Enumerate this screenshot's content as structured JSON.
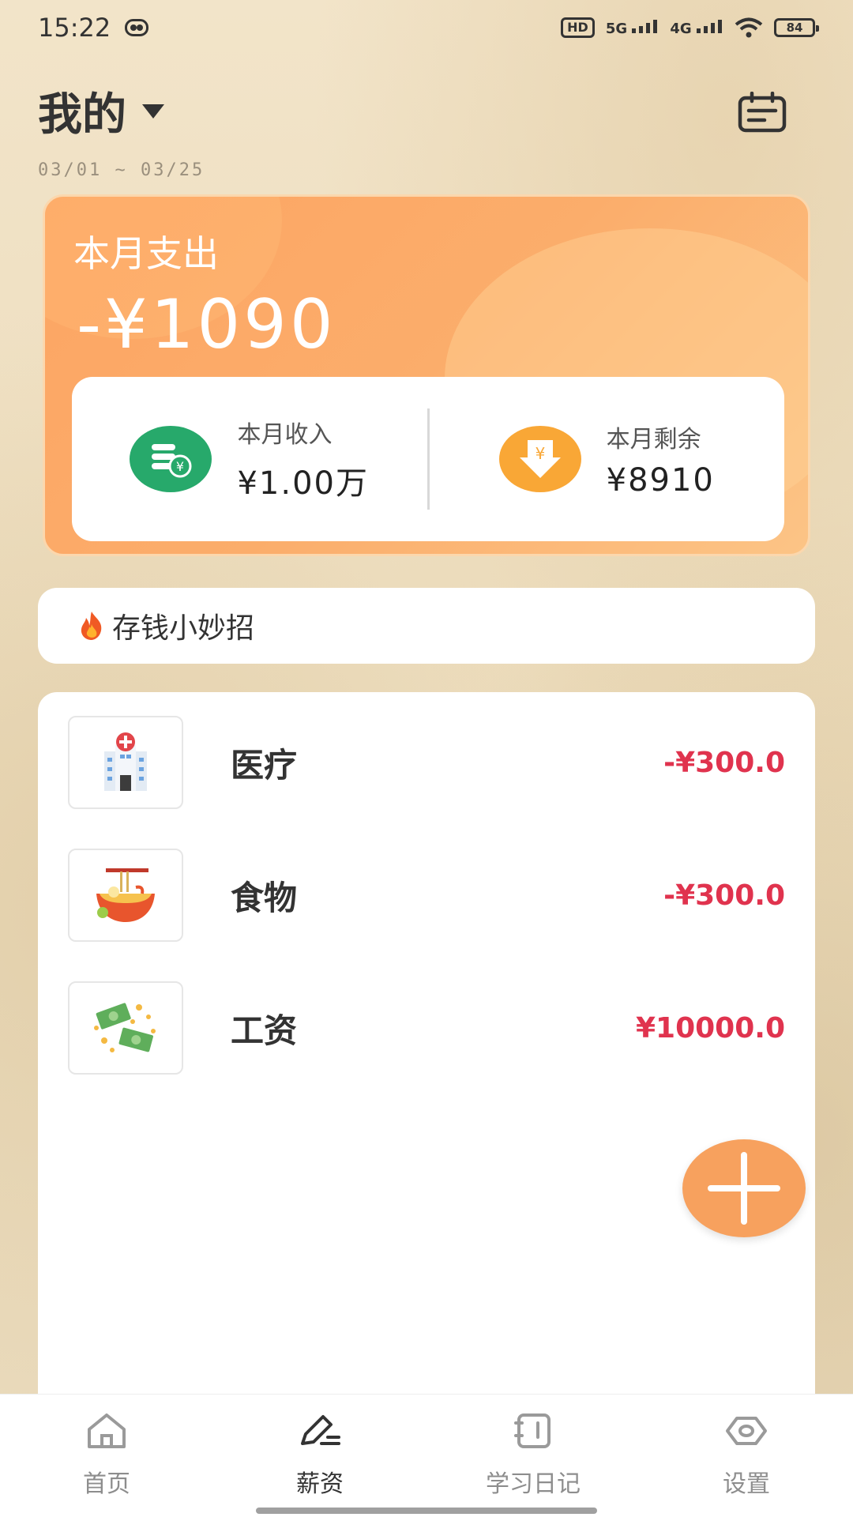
{
  "status_bar": {
    "time": "15:22",
    "hd_label": "HD",
    "net1": "5G",
    "net2": "4G",
    "battery": "84"
  },
  "header": {
    "title": "我的",
    "date_range": "03/01 ~ 03/25"
  },
  "summary": {
    "expense_label": "本月支出",
    "expense_amount": "-¥1090",
    "income_label": "本月收入",
    "income_value": "¥1.00万",
    "remaining_label": "本月剩余",
    "remaining_value": "¥8910"
  },
  "tips": {
    "icon": "fire-icon",
    "label": "存钱小妙招"
  },
  "transactions": [
    {
      "name": "医疗",
      "amount": "-¥300.0",
      "icon": "hospital-icon"
    },
    {
      "name": "食物",
      "amount": "-¥300.0",
      "icon": "noodle-bowl-icon"
    },
    {
      "name": "工资",
      "amount": "¥10000.0",
      "icon": "money-icon"
    }
  ],
  "bottom_nav": [
    {
      "label": "首页",
      "icon": "home-icon"
    },
    {
      "label": "薪资",
      "icon": "edit-icon"
    },
    {
      "label": "学习日记",
      "icon": "notebook-icon"
    },
    {
      "label": "设置",
      "icon": "eye-icon"
    }
  ],
  "colors": {
    "accent": "#f7a15e",
    "expense_red": "#e0334e",
    "income_green": "#27a96b",
    "remaining_orange": "#f9a736"
  }
}
